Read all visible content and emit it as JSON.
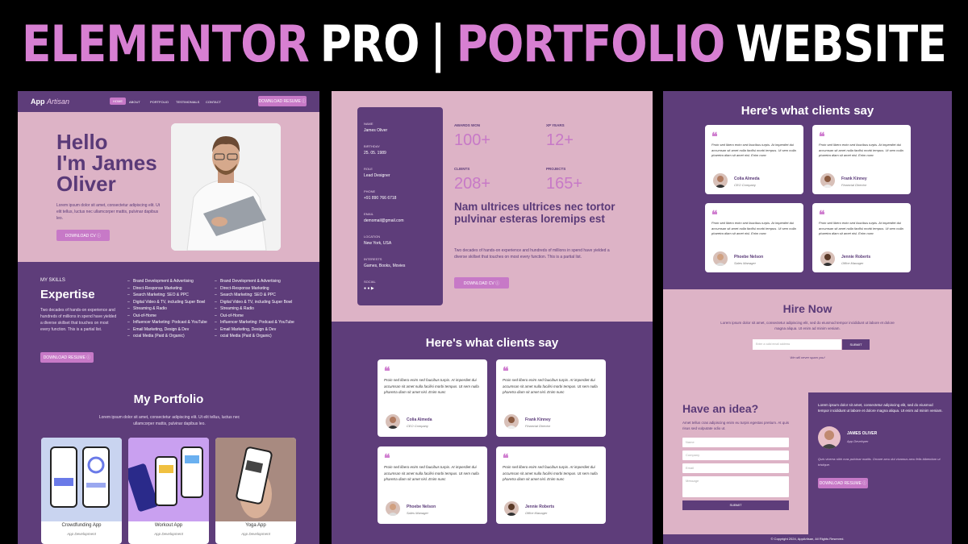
{
  "title": {
    "part1": "ELEMENTOR",
    "part2": "PRO",
    "sep": "|",
    "part3": "PORTFOLIO",
    "part4": "WEBSITE"
  },
  "p1": {
    "logo_a": "App",
    "logo_b": "Artisan",
    "nav": [
      "HOME",
      "ABOUT",
      "PORTFOLIO",
      "TESTIMONIALS",
      "CONTACT"
    ],
    "nav_button": "DOWNLOAD RESUME ⓘ",
    "hero_line1": "Hello",
    "hero_line2": "I'm James",
    "hero_line3": "Oliver",
    "hero_text": "Lorem ipsum dolor sit amet, consectetur adipiscing elit. Ut elit tellus, luctus nec ullamcorper mattis, pulvinar dapibus leo.",
    "hero_button": "DOWNLOAD CV ⓘ",
    "skills_label": "MY SKILLS",
    "skills_title": "Expertise",
    "skills_text": "Two decades of hands-on experience and hundreds of millions in spend have yielded a diverse skillset that touches on most every function. This is a partial list.",
    "skills_button": "DOWNLOAD RESUME ⓘ",
    "list_col1": [
      "Brand Development & Advertising",
      "Direct-Response Marketing",
      "Search Marketing: SEO & PPC",
      "Digital Video & TV, including Super Bowl",
      "Streaming & Radio",
      "Out-of-Home",
      "Influencer Marketing: Podcast & YouTube",
      "Email Marketing, Design & Dev",
      "ocial Media (Paid & Organic)"
    ],
    "list_col2": [
      "Brand Development & Advertising",
      "Direct-Response Marketing",
      "Search Marketing: SEO & PPC",
      "Digital Video & TV, including Super Bowl",
      "Streaming & Radio",
      "Out-of-Home",
      "Influencer Marketing: Podcast & YouTube",
      "Email Marketing, Design & Dev",
      "ocial Media (Paid & Organic)"
    ],
    "portfolio_title": "My Portfolio",
    "portfolio_text": "Lorem ipsum dolor sit amet, consectetur adipiscing elit. Ut elit tellus, luctus nec ullamcorper mattis, pulvinar dapibus leo.",
    "cards": [
      {
        "title": "Crowdfunding App",
        "sub": "App Development"
      },
      {
        "title": "Workout App",
        "sub": "App Development"
      },
      {
        "title": "Yoga App",
        "sub": "App Development"
      }
    ]
  },
  "p2": {
    "labels": [
      "NAME",
      "BIRTHDAY",
      "ROLE",
      "PHONE",
      "EMAIL",
      "LOCATION",
      "INTERESTS",
      "SOCIAL"
    ],
    "values": [
      "James Oliver",
      "25. 05. 1989",
      "Lead Designer",
      "+91 890 766 6718",
      "demomail@gmail.com",
      "New York, USA",
      "Games, Books, Movies",
      ""
    ],
    "stats": [
      {
        "label": "AWARDS WON",
        "value": "100+"
      },
      {
        "label": "XP YEARS",
        "value": "12+"
      },
      {
        "label": "CLIENTS",
        "value": "208+"
      },
      {
        "label": "PROJECTS",
        "value": "165+"
      }
    ],
    "heading": "Nam ultrices ultrices nec tortor pulvinar esteras loremips est",
    "text": "Two decades of hands-on experience and hundreds of millions in spend have yielded a diverse skillset that touches on most every function. This is a partial list.",
    "button": "DOWNLOAD CV ⓘ",
    "clients_title": "Here's what clients say"
  },
  "testimonial_text": "Proin sed libero enim sed faucibus turpis. At imperdiet dui accumsan sit amet nulla facilisi morbi tempus. Ut sem nulla pharetra diam sit amet nisl. Enim nunc",
  "people": [
    {
      "name": "Colia Almeda",
      "role": "CEO Company"
    },
    {
      "name": "Frank Kinney",
      "role": "Financial Director"
    },
    {
      "name": "Phoebe Nelson",
      "role": "Sales Manager"
    },
    {
      "name": "Jennie Roberts",
      "role": "Office Manager"
    }
  ],
  "p3": {
    "clients_title": "Here's what clients say",
    "hire_title": "Hire Now",
    "hire_text": "Lorem ipsum dolor sit amet, consectetur adipiscing elit, sed do eiusmod tempor incididunt ut labore et dolore magna aliqua. Ut enim ad minim veniam.",
    "email_placeholder": "Enter a valid email address",
    "submit": "SUBMIT",
    "spam_note": "We will never spam you!",
    "idea_title": "Have an idea?",
    "idea_text": "Amet tellus cras adipiscing enim eu turpis egestas pretium. At quis risus sed vulputate odio ut.",
    "fields": [
      "Name",
      "Company",
      "Email",
      "Message"
    ],
    "form_submit": "SUBMIT",
    "right_text": "Lorem ipsum dolor sit amet, consectetur adipiscing elit, sed do eiusmod tempor incididunt ut labore et dolore magna aliqua. Ut enim ad minim veniam.",
    "profile_name": "JAMES OLIVER",
    "profile_role": "App Developer",
    "profile_quote": "Quis viverra nibh cras pulvinar mattis. Ornare arcu dui vivamus arcu felis bibendum ut tristique.",
    "right_button": "DOWNLOAD RESUME ⓘ",
    "footer": "© Copyright 2024, AppArtisan, All Rights Reserved."
  }
}
